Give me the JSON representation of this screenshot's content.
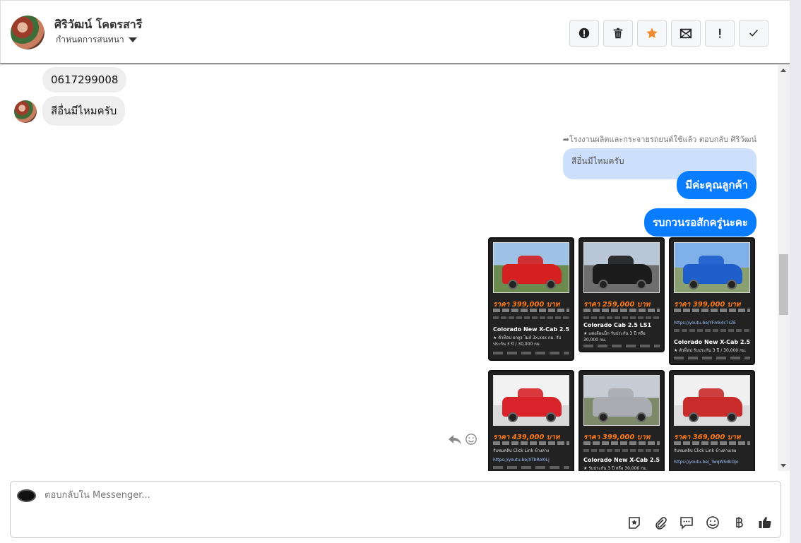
{
  "contact": {
    "name": "ศิริวัฒน์ โคตรสารี",
    "assign_label": "กำหนดการสนทนา"
  },
  "header_actions": [
    {
      "icon": "alert-circle-icon"
    },
    {
      "icon": "trash-icon"
    },
    {
      "icon": "star-icon",
      "color": "#f28b2e"
    },
    {
      "icon": "envelope-icon"
    },
    {
      "icon": "exclamation-icon"
    },
    {
      "icon": "check-icon"
    }
  ],
  "messages": {
    "incoming_1": "0617299008",
    "incoming_2": "สีอื่นมีไหมครับ",
    "reply_note": "โรงงานผลิตและกระจายรถยนต์ใช้แล้ว ตอบกลับ ศิริวัฒน์",
    "quoted_text": "สีอื่นมีไหมครับ",
    "outgoing_1": "มีค่ะคุณลูกค้า",
    "outgoing_2": "รบกวนรอสักครู่นะคะ"
  },
  "cards": [
    {
      "price": "ราคา 399,000 บาท",
      "model": "Colorado New X-Cab 2.5",
      "desc1": "★ ตัวท็อป ยกสูง ไมล์ 3x,xxx กม. รับ",
      "desc2": "ประกัน 3 ปี / 30,000 กม.",
      "car_color": "#d42020"
    },
    {
      "price": "ราคา 259,000 บาท",
      "model": "Colorado Cab 2.5 LS1",
      "desc1": "★ แต่งล้อแม็ก รับประกัน 3 ปี หรือ",
      "desc2": "30,000 กม.",
      "car_color": "#1c1c1c"
    },
    {
      "price": "ราคา 399,000 บาท",
      "model": "Colorado New X-Cab 2.5",
      "desc1": "https://youtu.be/YFmk4c7rZE",
      "desc2": "★ ตัวท็อป รับประกัน 3 ปี / 30,000 กม.",
      "car_color": "#1e5fcc"
    },
    {
      "price": "ราคา 439,000 บาท",
      "model": "",
      "desc1": "รับชมคลิป Click Link ข้างล่าง",
      "desc2": "https://youtu.be/XTbRoI0Lj",
      "car_color": "#d8232a"
    },
    {
      "price": "ราคา 399,000 บาท",
      "model": "Colorado New X-Cab 2.5",
      "desc1": "★ รับประกัน 3 ปี หรือ 30,000 กม.",
      "desc2": "",
      "car_color": "#a9adb1"
    },
    {
      "price": "ราคา 369,000 บาท",
      "model": "",
      "desc1": "รับชมคลิป Click Link ข้างล่างเลย",
      "desc2": "https://youtu.be/_TwqWSdkOjo",
      "car_color": "#c92a2a"
    }
  ],
  "composer": {
    "placeholder": "ตอบกลับใน Messenger..."
  },
  "composer_tools": [
    "sticker-icon",
    "paperclip-icon",
    "chat-bubble-icon",
    "emoji-icon",
    "baht-icon",
    "thumbs-up-icon"
  ],
  "accent_color": "#0a7cff"
}
